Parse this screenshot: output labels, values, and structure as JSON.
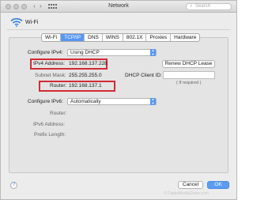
{
  "window": {
    "title": "Network",
    "search_placeholder": "Search"
  },
  "header": {
    "label": "Wi-Fi"
  },
  "tabs": [
    {
      "label": "Wi-Fi",
      "active": false
    },
    {
      "label": "TCP/IP",
      "active": true
    },
    {
      "label": "DNS",
      "active": false
    },
    {
      "label": "WINS",
      "active": false
    },
    {
      "label": "802.1X",
      "active": false
    },
    {
      "label": "Proxies",
      "active": false
    },
    {
      "label": "Hardware",
      "active": false
    }
  ],
  "ipv4": {
    "configure_label": "Configure IPv4:",
    "configure_value": "Using DHCP",
    "address_label": "IPv4 Address:",
    "address_value": "192.168.137.228",
    "subnet_label": "Subnet Mask:",
    "subnet_value": "255.255.255.0",
    "router_label": "Router:",
    "router_value": "192.168.137.1",
    "renew_button": "Renew DHCP Lease",
    "dhcp_client_label": "DHCP Client ID:",
    "dhcp_client_value": "",
    "if_required": "( If required )"
  },
  "ipv6": {
    "configure_label": "Configure IPv6:",
    "configure_value": "Automatically",
    "router_label": "Router:",
    "address_label": "IPv6 Address:",
    "prefix_label": "Prefix Length:"
  },
  "footer": {
    "help": "?",
    "cancel": "Cancel",
    "ok": "OK",
    "watermark": "© DigitalMediaGlobe.com"
  },
  "colors": {
    "accent": "#5797f3",
    "highlight_box": "#d22b35"
  }
}
